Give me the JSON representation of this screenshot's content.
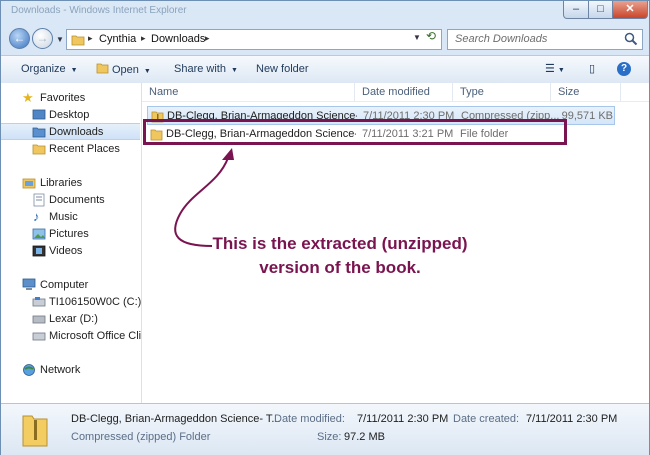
{
  "window": {
    "title": "Downloads - Windows Internet Explorer"
  },
  "address": {
    "crumbs": [
      "Cynthia",
      "Downloads"
    ]
  },
  "search": {
    "placeholder": "Search Downloads"
  },
  "toolbar": {
    "organize": "Organize",
    "open": "Open",
    "share_with": "Share with",
    "new_folder": "New folder"
  },
  "sidebar": {
    "favorites": {
      "header": "Favorites",
      "items": [
        "Desktop",
        "Downloads",
        "Recent Places"
      ]
    },
    "libraries": {
      "header": "Libraries",
      "items": [
        "Documents",
        "Music",
        "Pictures",
        "Videos"
      ]
    },
    "computer": {
      "header": "Computer",
      "items": [
        "TI106150W0C (C:)",
        "Lexar (D:)",
        "Microsoft Office Clic"
      ]
    },
    "network": {
      "header": "Network"
    }
  },
  "columns": {
    "name": "Name",
    "date": "Date modified",
    "type": "Type",
    "size": "Size"
  },
  "files": [
    {
      "name": "DB-Clegg, Brian-Armageddon Science- T...",
      "date": "7/11/2011 2:30 PM",
      "type": "Compressed (zipp...",
      "size": "99,571 KB"
    },
    {
      "name": "DB-Clegg, Brian-Armageddon Science- T...",
      "date": "7/11/2011 3:21 PM",
      "type": "File folder",
      "size": ""
    }
  ],
  "annotation": {
    "line1": "This is the extracted (unzipped)",
    "line2": "version of the book."
  },
  "details": {
    "name": "DB-Clegg, Brian-Armageddon Science- T...",
    "type": "Compressed (zipped) Folder",
    "modified_label": "Date modified:",
    "modified_value": "7/11/2011 2:30 PM",
    "created_label": "Date created:",
    "created_value": "7/11/2011 2:30 PM",
    "size_label": "Size:",
    "size_value": "97.2 MB"
  },
  "colors": {
    "annotation": "#7a1450",
    "selection": "#d5e6f8"
  }
}
